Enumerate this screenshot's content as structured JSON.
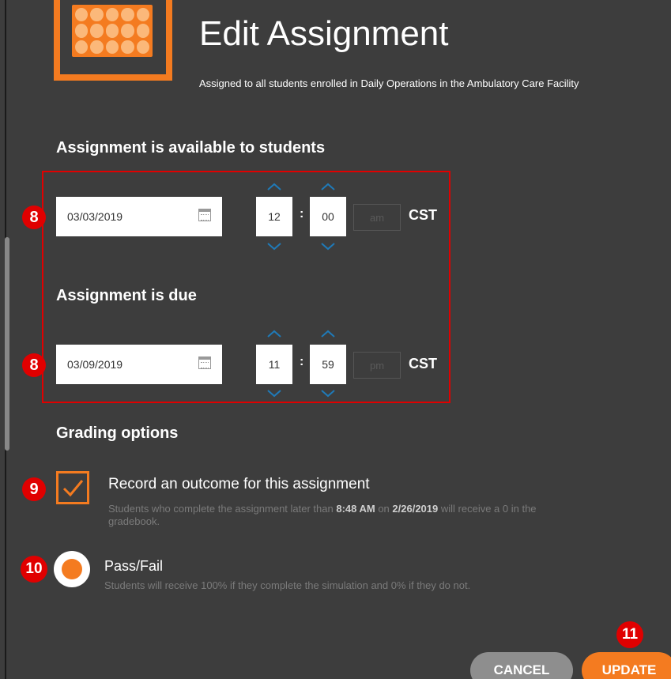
{
  "header": {
    "title": "Edit Assignment",
    "subtitle": "Assigned to all students enrolled in Daily Operations in the Ambulatory Care Facility"
  },
  "availability": {
    "heading": "Assignment is available to students",
    "marker": "8",
    "date": "03/03/2019",
    "hour": "12",
    "minute": "00",
    "ampm": "am",
    "timezone": "CST"
  },
  "due": {
    "heading": "Assignment is due",
    "marker": "8",
    "date": "03/09/2019",
    "hour": "11",
    "minute": "59",
    "ampm": "pm",
    "timezone": "CST"
  },
  "grading": {
    "heading": "Grading options",
    "outcome": {
      "marker": "9",
      "label": "Record an outcome for this assignment",
      "help_prefix": "Students who complete the assignment later than ",
      "help_time": "8:48 AM",
      "help_mid": " on ",
      "help_date": "2/26/2019",
      "help_suffix": " will receive a 0 in the",
      "help_line2": "gradebook.",
      "checked": true
    },
    "passfail": {
      "marker": "10",
      "label": "Pass/Fail",
      "help": "Students will receive 100% if they complete the simulation and 0% if they do not.",
      "selected": true
    }
  },
  "footer": {
    "marker": "11",
    "cancel_label": "CANCEL",
    "update_label": "UPDATE"
  },
  "colors": {
    "accent": "#f47b20",
    "background": "#3d3d3d",
    "annotation_red": "#e00000",
    "spinner_blue": "#1f7ab8"
  },
  "icons": [
    "calendar-icon",
    "chevron-up-icon",
    "chevron-down-icon",
    "checkmark-icon"
  ]
}
